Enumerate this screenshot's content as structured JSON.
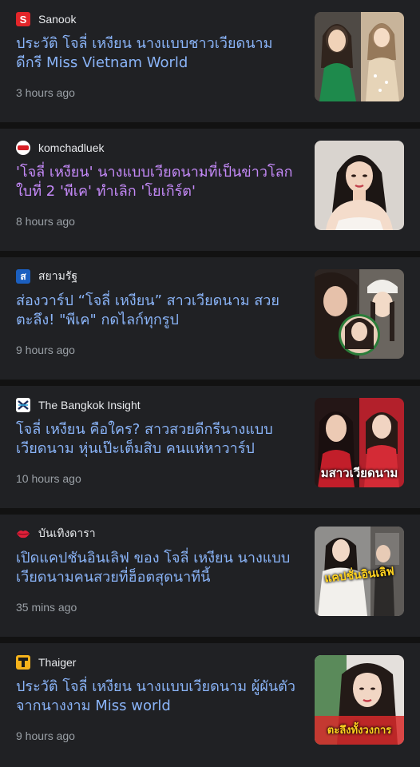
{
  "articles": [
    {
      "source": "Sanook",
      "source_icon": "sanook-logo-icon",
      "headline": "ประวัติ โจลี่ เหงียน นางแบบชาวเวียดนาม ดีกรี Miss Vietnam World",
      "time": "3 hours ago",
      "visited": false
    },
    {
      "source": "komchadluek",
      "source_icon": "komchadluek-logo-icon",
      "headline": "'โจลี่ เหงียน' นางแบบเวียดนามที่เป็นข่าวโลก ใบที่ 2 'พีเค' ทำเลิก 'โยเกิร์ต'",
      "time": "8 hours ago",
      "visited": true
    },
    {
      "source": "สยามรัฐ",
      "source_icon": "siamrath-logo-icon",
      "headline": "ส่องวาร์ป “โจลี่ เหงียน” สาวเวียดนาม สวยตะลึง! \"พีเค\" กดไลก์ทุกรูป",
      "time": "9 hours ago",
      "visited": false
    },
    {
      "source": "The Bangkok Insight",
      "source_icon": "bangkok-insight-logo-icon",
      "headline": "โจลี่ เหงียน คือใคร? สาวสวยดีกรีนางแบบเวียดนาม หุ่นเป๊ะเต็มสิบ คนแห่หาวาร์ป",
      "time": "10 hours ago",
      "visited": false,
      "thumb_overlay": "มสาวเวียดนาม"
    },
    {
      "source": "บันเทิงดารา",
      "source_icon": "lips-logo-icon",
      "headline": "เปิดแคปชันอินเลิฟ ของ โจลี่ เหงียน นางแบบเวียดนามคนสวยที่ฮ็อตสุดนาทีนี้",
      "time": "35 mins ago",
      "visited": false,
      "thumb_overlay": "แคปชั่นอินเลิฟ"
    },
    {
      "source": "Thaiger",
      "source_icon": "thaiger-logo-icon",
      "headline": "ประวัติ โจลี่ เหงียน นางแบบเวียดนาม ผู้ผันตัวจากนางงาม Miss world",
      "time": "9 hours ago",
      "visited": false,
      "thumb_overlay": "ตะลึงทั้งวงการ"
    }
  ],
  "colors": {
    "background": "#121212",
    "card": "#202124",
    "link": "#8ab4f8",
    "visited_link": "#c58af9",
    "meta_text": "#9aa0a6"
  }
}
